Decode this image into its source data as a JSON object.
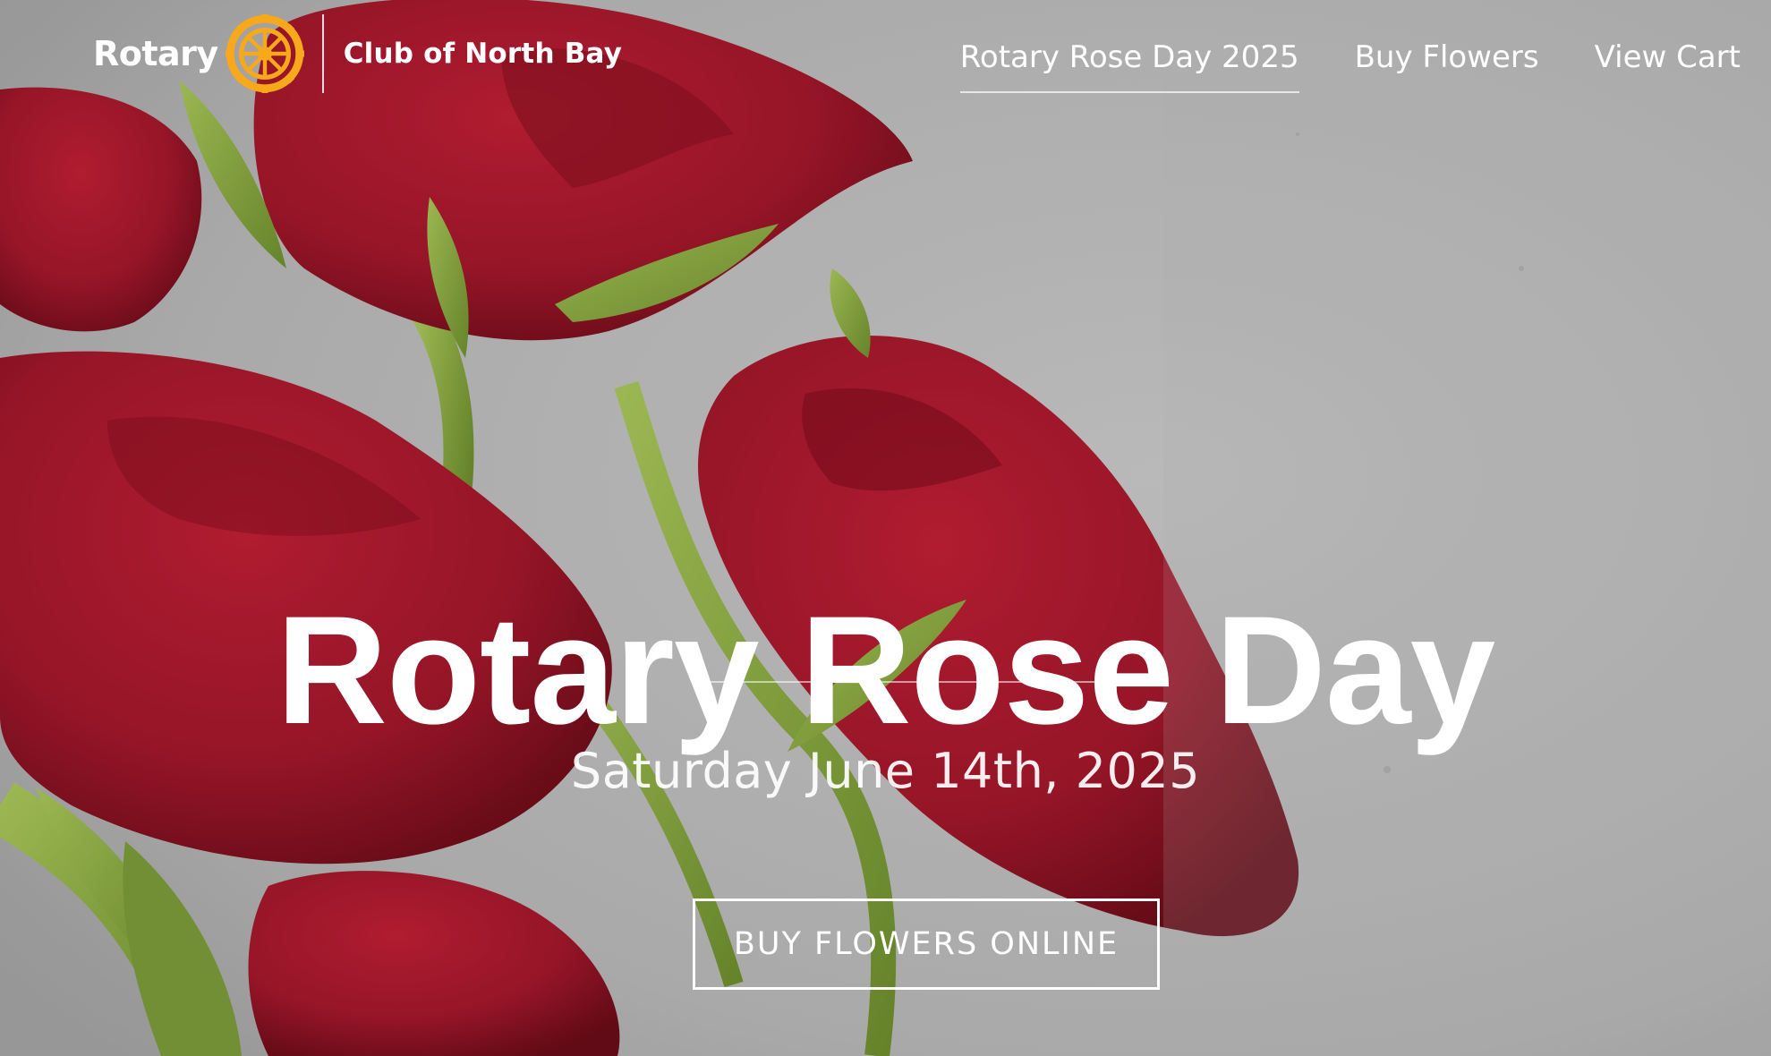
{
  "header": {
    "logo_word": "Rotary",
    "club_name": "Club of North Bay",
    "nav": [
      {
        "label": "Rotary Rose Day 2025",
        "active": true
      },
      {
        "label": "Buy Flowers",
        "active": false
      },
      {
        "label": "View Cart",
        "active": false
      }
    ]
  },
  "hero": {
    "title": "Rotary Rose Day",
    "date": "Saturday June 14th, 2025",
    "cta_label": "BUY FLOWERS ONLINE",
    "background_image": "red-roses-on-grey-concrete"
  },
  "colors": {
    "rose_red": "#a8182c",
    "rose_dark": "#6d0c18",
    "stem_green": "#8fb043",
    "background_grey": "#bcbcbc",
    "rotary_gold": "#f7a81b",
    "text_white": "#ffffff"
  },
  "icons": {
    "logo_emblem": "rotary-wheel-icon"
  }
}
